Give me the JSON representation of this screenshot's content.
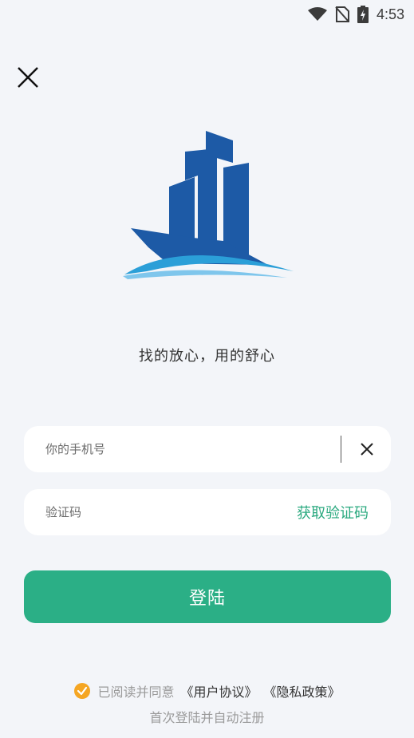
{
  "status_bar": {
    "time": "4:53"
  },
  "slogan": "找的放心，用的舒心",
  "phone_field": {
    "placeholder": "你的手机号",
    "value": ""
  },
  "code_field": {
    "placeholder": "验证码",
    "value": "",
    "get_code_label": "获取验证码"
  },
  "login_button": {
    "label": "登陆"
  },
  "agreement": {
    "checked": true,
    "text": "已阅读并同意",
    "user_agreement": "《用户协议》",
    "privacy_policy": "《隐私政策》"
  },
  "auto_register_note": "首次登陆并自动注册",
  "colors": {
    "accent": "#2baf86",
    "check": "#f5a623",
    "logo_blue": "#1d5aa6",
    "logo_wave": "#2b9fd8"
  }
}
